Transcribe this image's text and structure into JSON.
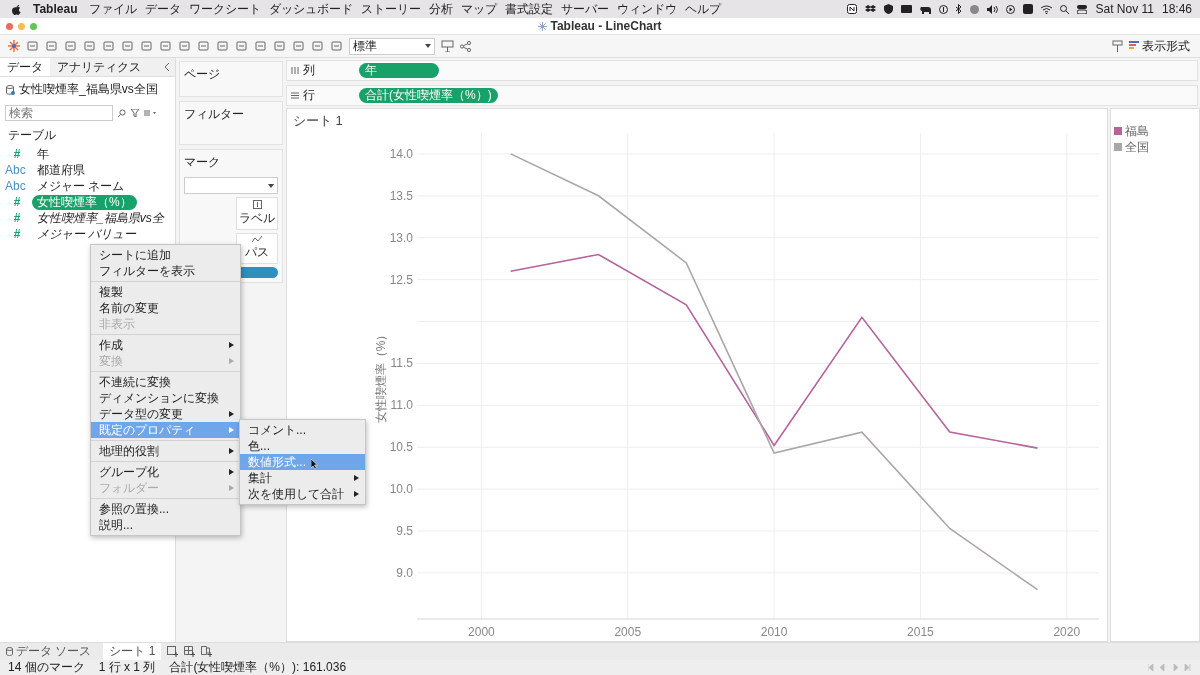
{
  "menubar": {
    "app": "Tableau",
    "menus": [
      "ファイル",
      "データ",
      "ワークシート",
      "ダッシュボード",
      "ストーリー",
      "分析",
      "マップ",
      "書式設定",
      "サーバー",
      "ウィンドウ",
      "ヘルプ"
    ],
    "date": "Sat Nov 11",
    "time": "18:46"
  },
  "window": {
    "title": "Tableau - LineChart"
  },
  "toolbar": {
    "mark_size": "標準",
    "show_me": "表示形式"
  },
  "data_pane": {
    "tabs": [
      {
        "label": "データ",
        "selected": true
      },
      {
        "label": "アナリティクス",
        "selected": false
      }
    ],
    "source": "女性喫煙率_福島県vs全国",
    "search": {
      "placeholder": "検索"
    },
    "section": "テーブル",
    "fields": [
      {
        "kind": "measure",
        "type_icon": "#",
        "label": "年",
        "italic": false,
        "selected": false
      },
      {
        "kind": "dimension",
        "type_icon": "Abc",
        "label": "都道府県",
        "italic": false,
        "selected": false
      },
      {
        "kind": "dimension",
        "type_icon": "Abc",
        "label": "メジャー ネーム",
        "italic": false,
        "selected": false
      },
      {
        "kind": "measure",
        "type_icon": "#",
        "label": "女性喫煙率（%）",
        "italic": false,
        "selected": true
      },
      {
        "kind": "measure",
        "type_icon": "#",
        "label": "女性喫煙率_福島県vs全",
        "italic": true,
        "selected": false
      },
      {
        "kind": "measure",
        "type_icon": "#",
        "label": "メジャー バリュー",
        "italic": true,
        "selected": false
      }
    ]
  },
  "cards": {
    "pages": "ページ",
    "filters": "フィルター",
    "marks": "マーク",
    "mark_buttons": [
      "ラベル",
      "パス"
    ]
  },
  "shelves": [
    {
      "label": "列",
      "pill": "年"
    },
    {
      "label": "行",
      "pill": "合計(女性喫煙率（%）)"
    }
  ],
  "sheet": {
    "title": "シート 1",
    "chart_data": {
      "type": "line",
      "ylabel": "女性喫煙率（%）",
      "x": [
        2001,
        2004,
        2007,
        2010,
        2013,
        2016,
        2019
      ],
      "series": [
        {
          "name": "福島",
          "color": "#b5649d",
          "values": [
            12.6,
            12.8,
            12.2,
            10.52,
            12.05,
            10.68,
            10.49
          ]
        },
        {
          "name": "全国",
          "color": "#aaa6a9",
          "values": [
            14.0,
            13.5,
            12.7,
            10.43,
            10.68,
            9.53,
            8.8
          ]
        }
      ],
      "grid": true,
      "xlim": [
        1997.8,
        2021.1
      ],
      "ylim": [
        8.45,
        14.25
      ],
      "xticks": [
        2000,
        2005,
        2010,
        2015,
        2020
      ],
      "yticks": [
        {
          "value": 9,
          "label": "9.0"
        },
        {
          "value": 9.5,
          "label": "9.5"
        },
        {
          "value": 10,
          "label": "10.0"
        },
        {
          "value": 10.5,
          "label": "10.5"
        },
        {
          "value": 11,
          "label": "11.0"
        },
        {
          "value": 11.5,
          "label": "11.5"
        },
        {
          "value": 12.5,
          "label": "12.5"
        },
        {
          "value": 13,
          "label": "13.0"
        },
        {
          "value": 13.5,
          "label": "13.5"
        },
        {
          "value": 14,
          "label": "14.0"
        }
      ]
    }
  },
  "context_menu": {
    "groups": [
      [
        {
          "label": "シートに追加",
          "disabled": false,
          "submenu": false,
          "selected": false
        },
        {
          "label": "フィルターを表示",
          "disabled": false,
          "submenu": false,
          "selected": false
        }
      ],
      [
        {
          "label": "複製",
          "disabled": false,
          "submenu": false,
          "selected": false
        },
        {
          "label": "名前の変更",
          "disabled": false,
          "submenu": false,
          "selected": false
        },
        {
          "label": "非表示",
          "disabled": true,
          "submenu": false,
          "selected": false
        }
      ],
      [
        {
          "label": "作成",
          "disabled": false,
          "submenu": true,
          "selected": false
        },
        {
          "label": "変換",
          "disabled": true,
          "submenu": true,
          "selected": false
        }
      ],
      [
        {
          "label": "不連続に変換",
          "disabled": false,
          "submenu": false,
          "selected": false
        },
        {
          "label": "ディメンションに変換",
          "disabled": false,
          "submenu": false,
          "selected": false
        },
        {
          "label": "データ型の変更",
          "disabled": false,
          "submenu": true,
          "selected": false
        },
        {
          "label": "既定のプロパティ",
          "disabled": false,
          "submenu": true,
          "selected": true
        }
      ],
      [
        {
          "label": "地理的役割",
          "disabled": false,
          "submenu": true,
          "selected": false
        }
      ],
      [
        {
          "label": "グループ化",
          "disabled": false,
          "submenu": true,
          "selected": false
        },
        {
          "label": "フォルダー",
          "disabled": true,
          "submenu": true,
          "selected": false
        }
      ],
      [
        {
          "label": "参照の置換...",
          "disabled": false,
          "submenu": false,
          "selected": false
        },
        {
          "label": "説明...",
          "disabled": false,
          "submenu": false,
          "selected": false
        }
      ]
    ]
  },
  "submenu": [
    {
      "label": "コメント...",
      "submenu": false,
      "selected": false
    },
    {
      "label": "色...",
      "submenu": false,
      "selected": false
    },
    {
      "label": "数値形式...",
      "submenu": false,
      "selected": true
    },
    {
      "label": "集計",
      "submenu": true,
      "selected": false
    },
    {
      "label": "次を使用して合計",
      "submenu": true,
      "selected": false
    }
  ],
  "bottom_tabs": [
    {
      "label": "データ ソース",
      "kind": "source",
      "selected": false
    },
    {
      "label": "シート 1",
      "kind": "sheet",
      "selected": true
    }
  ],
  "status_bar": [
    "14 個のマーク",
    "1 行 x 1 列",
    "合計(女性喫煙率（%）): 161.036"
  ]
}
